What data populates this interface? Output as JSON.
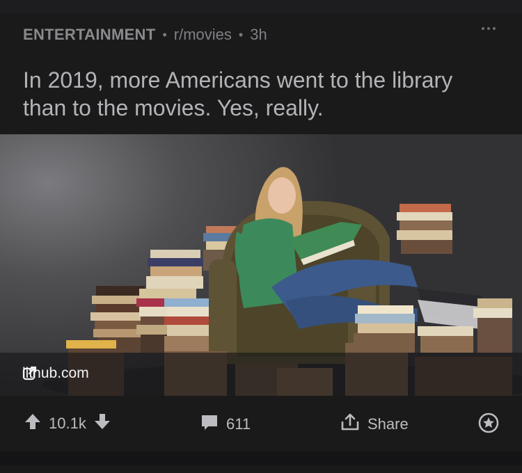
{
  "post": {
    "category": "ENTERTAINMENT",
    "subreddit": "r/movies",
    "age": "3h",
    "separator": "•",
    "title": "In 2019, more Americans went to the library than to the movies. Yes, really.",
    "link_domain": "lithub.com"
  },
  "actions": {
    "score": "10.1k",
    "comments": "611",
    "share_label": "Share"
  },
  "icons": {
    "more": "more-horizontal-icon",
    "external_link": "external-link-icon",
    "upvote": "arrow-up-icon",
    "downvote": "arrow-down-icon",
    "comment": "comment-bubble-icon",
    "share": "share-upload-icon",
    "award": "award-star-icon"
  },
  "colors": {
    "background": "#1a1a1b",
    "text_primary": "#b4b4b8",
    "text_muted": "#8a8a8d"
  }
}
